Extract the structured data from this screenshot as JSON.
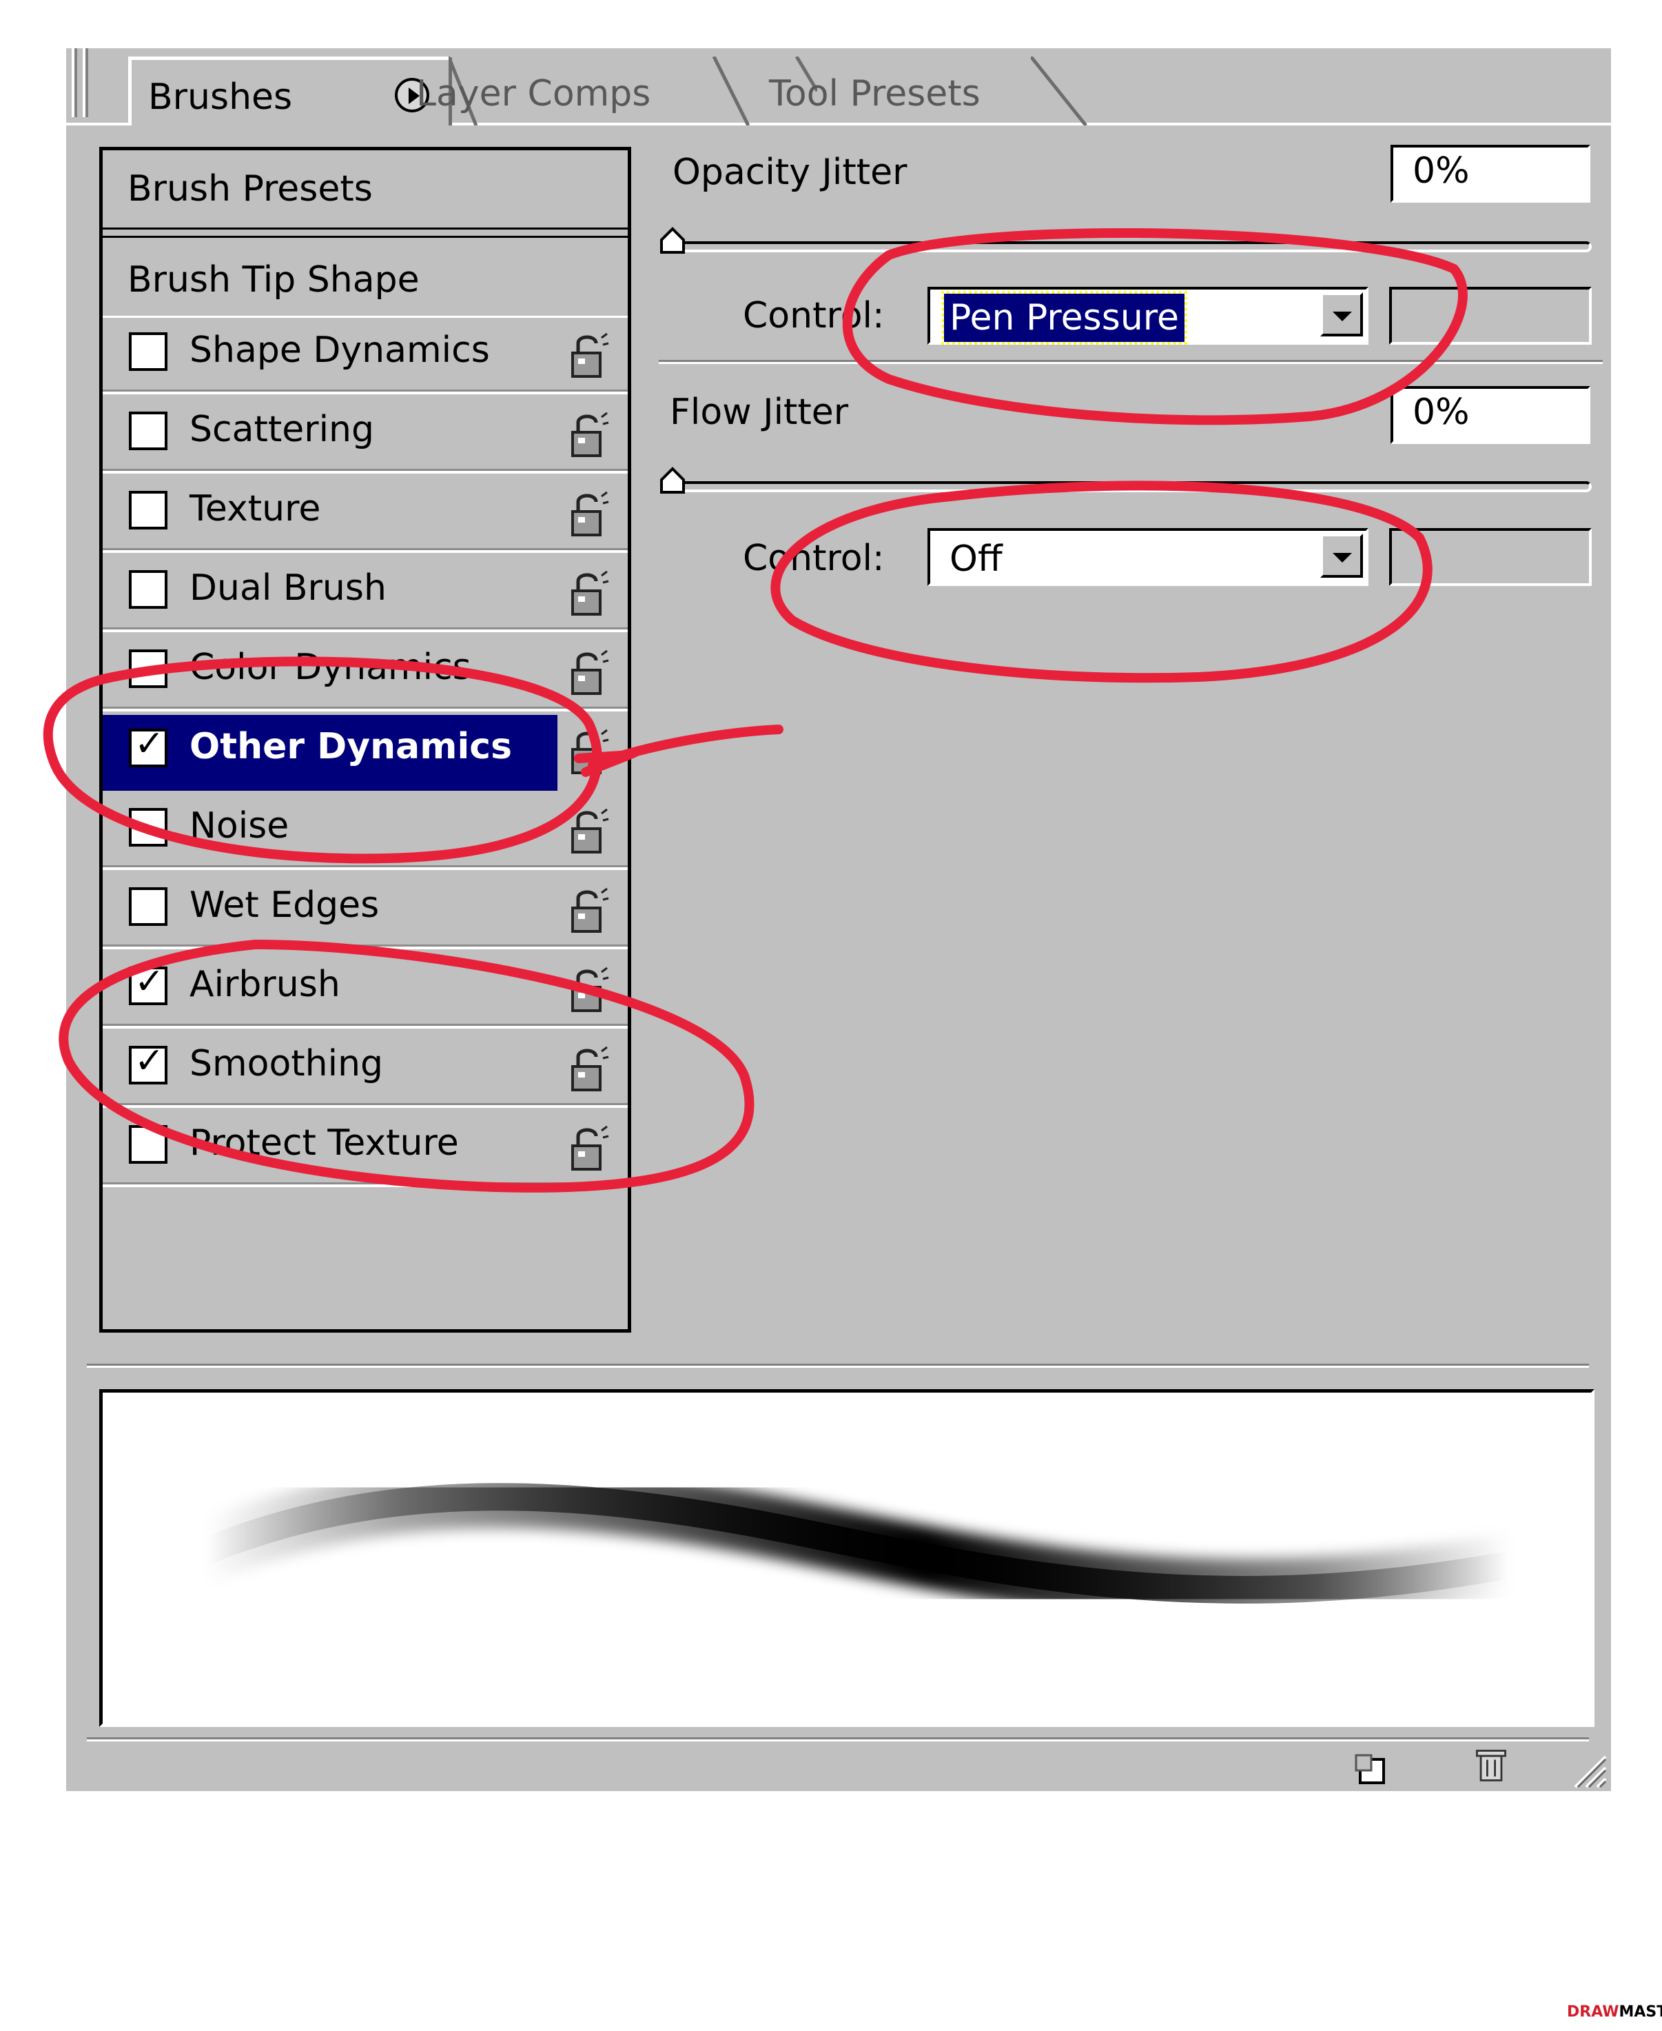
{
  "tabs": [
    {
      "label": "Brushes"
    },
    {
      "label": "Layer Comps"
    },
    {
      "label": "Tool Presets"
    }
  ],
  "sidebar": {
    "presets_label": "Brush Presets",
    "tip_shape_label": "Brush Tip Shape",
    "items": [
      {
        "label": "Shape Dynamics",
        "checked": false
      },
      {
        "label": "Scattering",
        "checked": false
      },
      {
        "label": "Texture",
        "checked": false
      },
      {
        "label": "Dual Brush",
        "checked": false
      },
      {
        "label": "Color Dynamics",
        "checked": false
      },
      {
        "label": "Other Dynamics",
        "checked": true,
        "selected": true
      },
      {
        "label": "Noise",
        "checked": false
      },
      {
        "label": "Wet Edges",
        "checked": false
      },
      {
        "label": "Airbrush",
        "checked": true
      },
      {
        "label": "Smoothing",
        "checked": true
      },
      {
        "label": "Protect Texture",
        "checked": false
      }
    ]
  },
  "settings": {
    "opacity_jitter": {
      "label": "Opacity Jitter",
      "value": "0%",
      "slider_level": 0
    },
    "opacity_control": {
      "label": "Control:",
      "value": "Pen Pressure"
    },
    "flow_jitter": {
      "label": "Flow Jitter",
      "value": "0%",
      "slider_level": 0
    },
    "flow_control": {
      "label": "Control:",
      "value": "Off"
    }
  },
  "colors": {
    "panel": "#c0c0c0",
    "selection": "#00007a",
    "annotation": "#e8213a"
  },
  "icons": [
    "panel-menu-icon",
    "lock-icon",
    "new-brush-icon",
    "trash-icon",
    "resize-grip-icon"
  ],
  "watermark": {
    "part1": "DRAW",
    "part2": "MASTER.RU"
  }
}
